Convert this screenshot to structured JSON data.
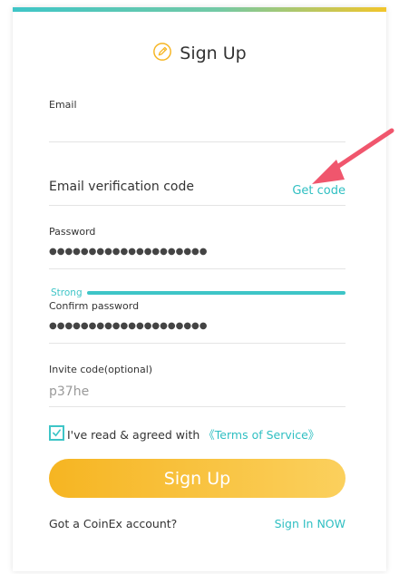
{
  "header": {
    "title": "Sign Up",
    "icon": "pencil-circle-icon"
  },
  "form": {
    "email_label": "Email",
    "verification_label": "Email verification code",
    "get_code": "Get code",
    "password_label": "Password",
    "password_value": "●●●●●●●●●●●●●●●●●●●●",
    "strength": "Strong",
    "confirm_label": "Confirm password",
    "confirm_value": "●●●●●●●●●●●●●●●●●●●●",
    "invite_label": "Invite code(optional)",
    "invite_value": "p37he",
    "agree_text": "I've read & agreed with ",
    "terms_link": "《Terms of Service》",
    "agree_checked": true,
    "submit_label": "Sign Up"
  },
  "footer": {
    "question": "Got a CoinEx account?",
    "signin_link": "Sign In NOW"
  },
  "colors": {
    "accent": "#3ec5c7",
    "button": "#f6b522",
    "arrow": "#f0566d"
  }
}
